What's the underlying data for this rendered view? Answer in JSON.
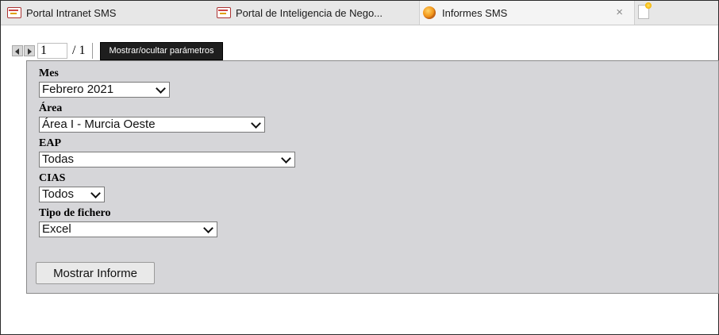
{
  "tabs": [
    {
      "label": "Portal Intranet SMS",
      "icon": "sms-logo-icon"
    },
    {
      "label": "Portal de Inteligencia de Nego...",
      "icon": "sms-logo-icon"
    },
    {
      "label": "Informes SMS",
      "icon": "globe-icon",
      "active": true,
      "close": "×"
    }
  ],
  "toolbar": {
    "page_current": "1",
    "page_total": "/ 1",
    "toggle_label": "Mostrar/ocultar parámetros"
  },
  "params": {
    "mes": {
      "label": "Mes",
      "value": "Febrero 2021"
    },
    "area": {
      "label": "Área",
      "value": "Área I - Murcia Oeste"
    },
    "eap": {
      "label": "EAP",
      "value": "Todas"
    },
    "cias": {
      "label": "CIAS",
      "value": "Todos"
    },
    "tipo": {
      "label": "Tipo de fichero",
      "value": "Excel"
    }
  },
  "actions": {
    "show_report": "Mostrar Informe"
  },
  "colors": {
    "panel_bg": "#d6d6d9",
    "toggle_bg": "#1e1e1e",
    "tabbar_bg": "#e7e7e7"
  }
}
